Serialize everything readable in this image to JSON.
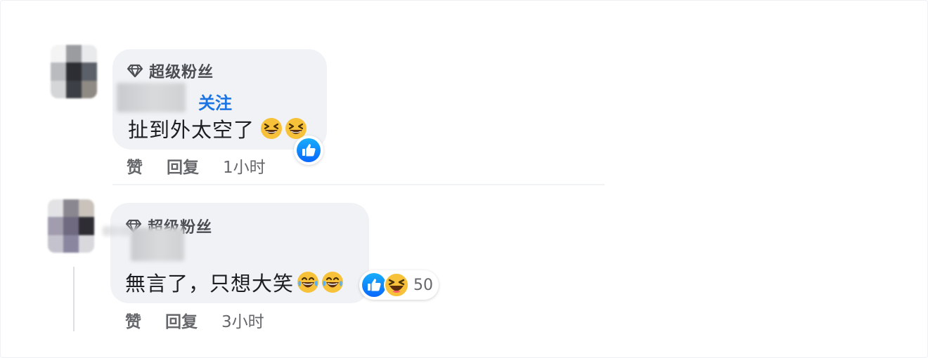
{
  "comments": [
    {
      "badge_label": "超级粉丝",
      "follow_label": "关注",
      "text": "扯到外太空了",
      "text_emoji": [
        "grinning-squint-emoji",
        "grinning-squint-emoji"
      ],
      "reactions": {
        "icons": [
          "like"
        ],
        "count": ""
      },
      "actions": {
        "like_label": "赞",
        "reply_label": "回复",
        "time": "1小时"
      }
    },
    {
      "badge_label": "超级粉丝",
      "text": "無言了，只想大笑",
      "text_emoji": [
        "tears-of-joy-emoji",
        "tears-of-joy-emoji"
      ],
      "reactions": {
        "icons": [
          "like",
          "haha"
        ],
        "count": "50"
      },
      "actions": {
        "like_label": "赞",
        "reply_label": "回复",
        "time": "3小时"
      }
    }
  ],
  "colors": {
    "bubble": "#f0f2f5",
    "link_blue": "#1b74e4",
    "like_blue": "#1877f2",
    "meta_gray": "#65676b",
    "emoji_yellow": "#f7c23a"
  }
}
